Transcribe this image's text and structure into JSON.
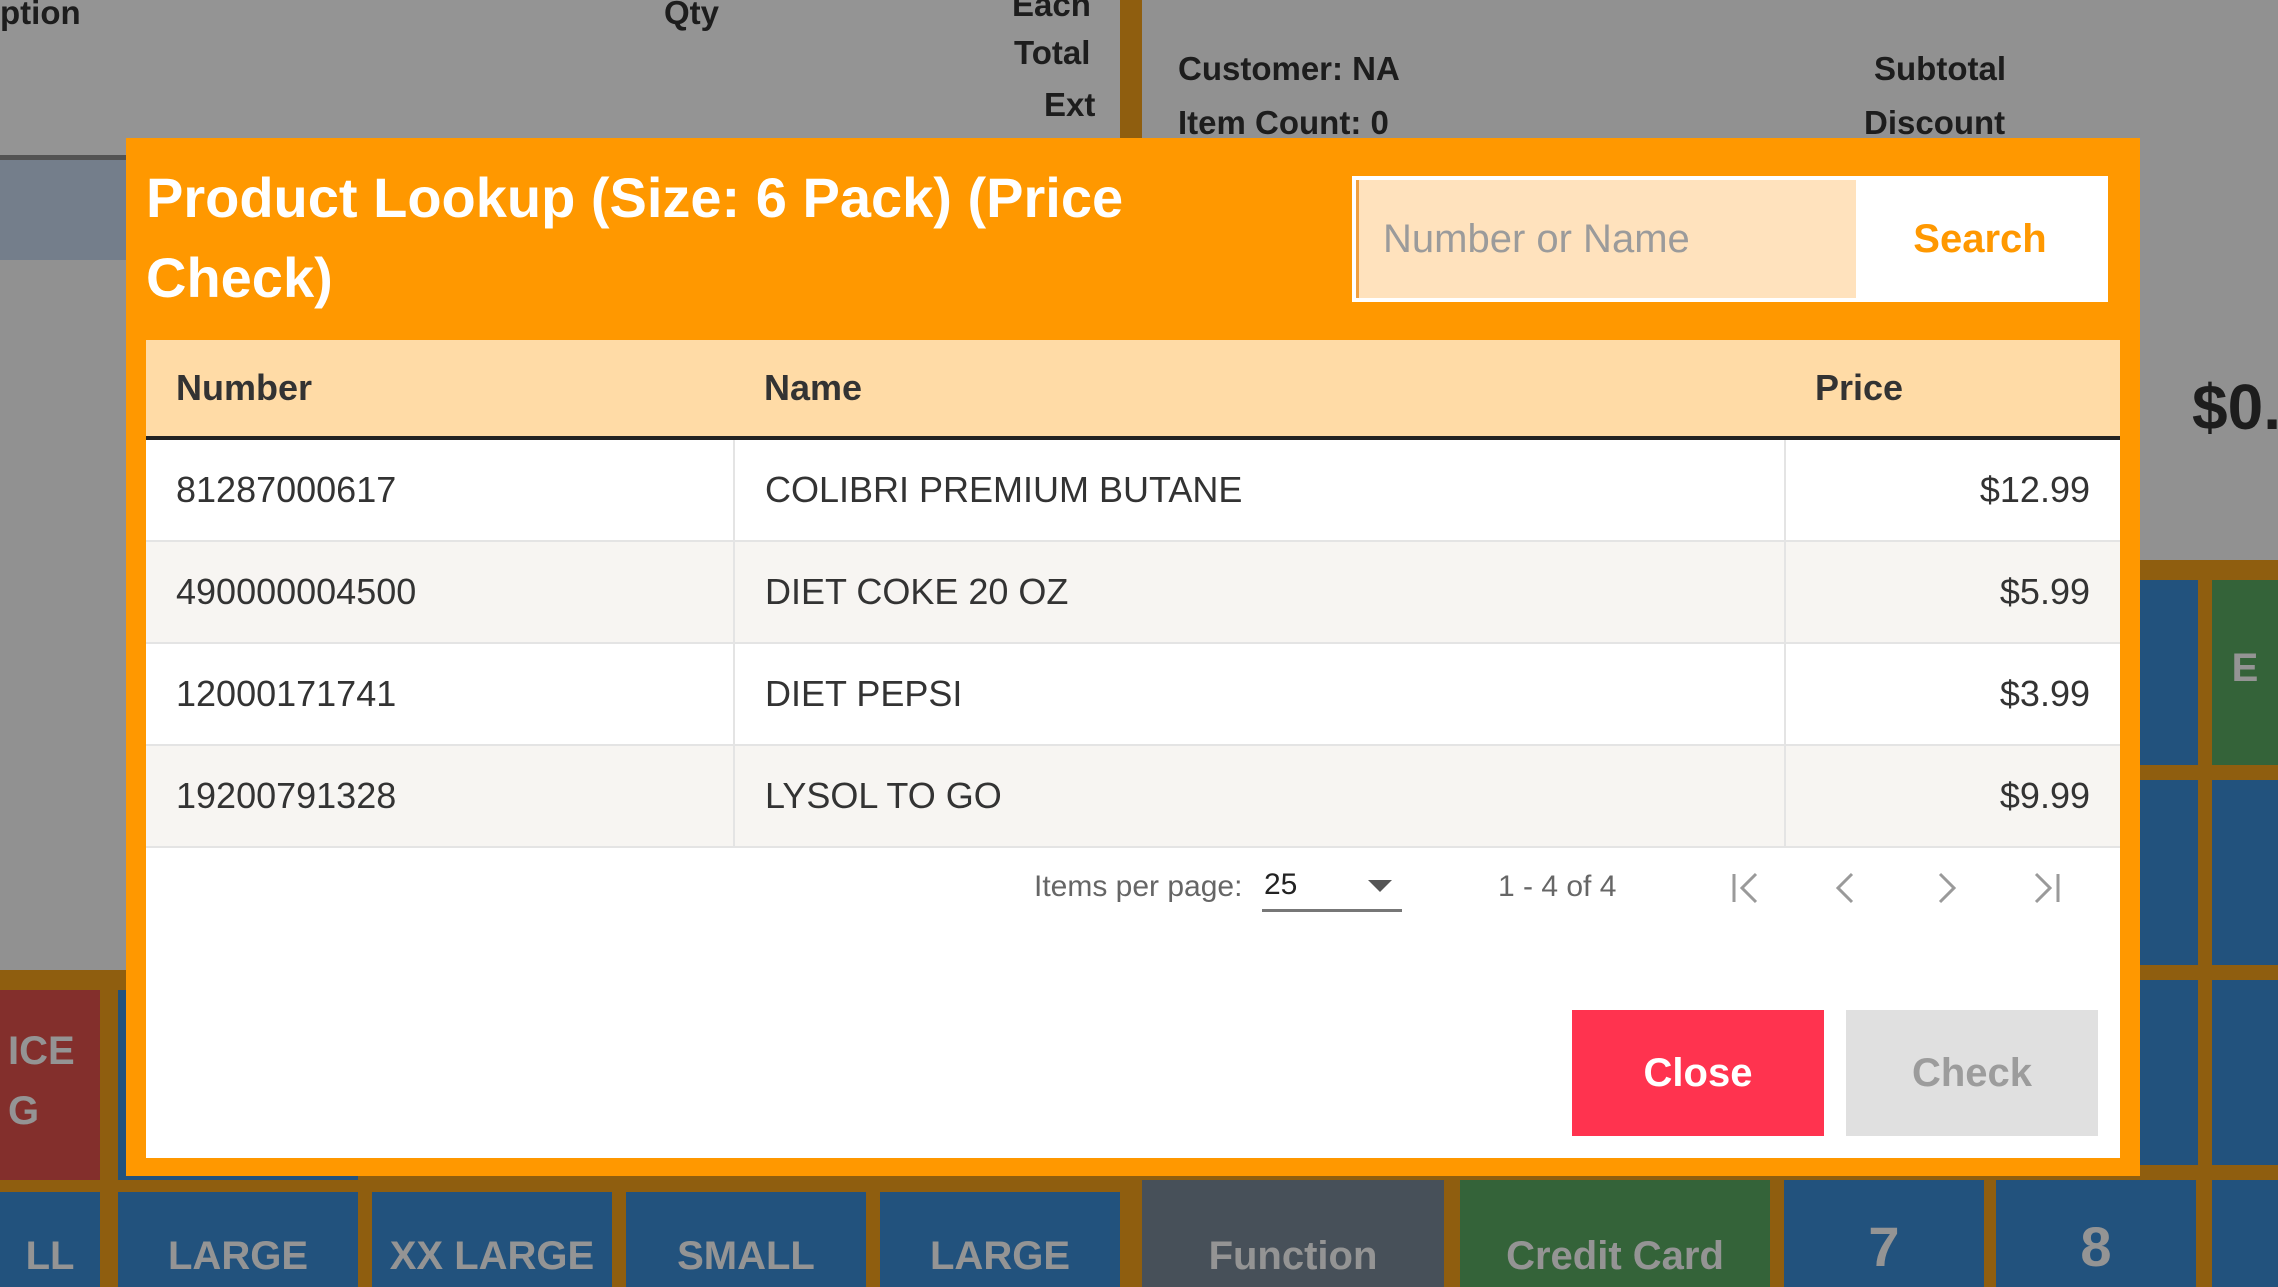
{
  "background": {
    "columns": {
      "description": "ption",
      "qty": "Qty",
      "each": "Each",
      "total": "Total",
      "ext": "Ext"
    },
    "summary": {
      "customer": "Customer: NA",
      "item_count": "Item Count: 0",
      "subtotal": "Subtotal",
      "discount": "Discount",
      "total_amount": "$0."
    },
    "buttons": {
      "ice": "ICE G",
      "ll": "LL",
      "large1": "LARGE",
      "xx_large": "XX LARGE",
      "small": "SMALL",
      "large2": "LARGE",
      "function": "Function",
      "credit_card": "Credit Card",
      "seven": "7",
      "eight": "8",
      "e": "E"
    }
  },
  "modal": {
    "title": "Product Lookup (Size: 6 Pack) (Price Check)",
    "search": {
      "placeholder": "Number or Name",
      "value": "",
      "button_label": "Search"
    },
    "table": {
      "headers": {
        "number": "Number",
        "name": "Name",
        "price": "Price"
      },
      "rows": [
        {
          "number": "81287000617",
          "name": "COLIBRI PREMIUM BUTANE",
          "price": "$12.99"
        },
        {
          "number": "490000004500",
          "name": "DIET COKE 20 OZ",
          "price": "$5.99"
        },
        {
          "number": "12000171741",
          "name": "DIET PEPSI",
          "price": "$3.99"
        },
        {
          "number": "19200791328",
          "name": "LYSOL TO GO",
          "price": "$9.99"
        }
      ]
    },
    "paginator": {
      "items_per_page_label": "Items per page:",
      "items_per_page": "25",
      "range": "1 - 4 of 4"
    },
    "actions": {
      "close": "Close",
      "check": "Check"
    }
  }
}
